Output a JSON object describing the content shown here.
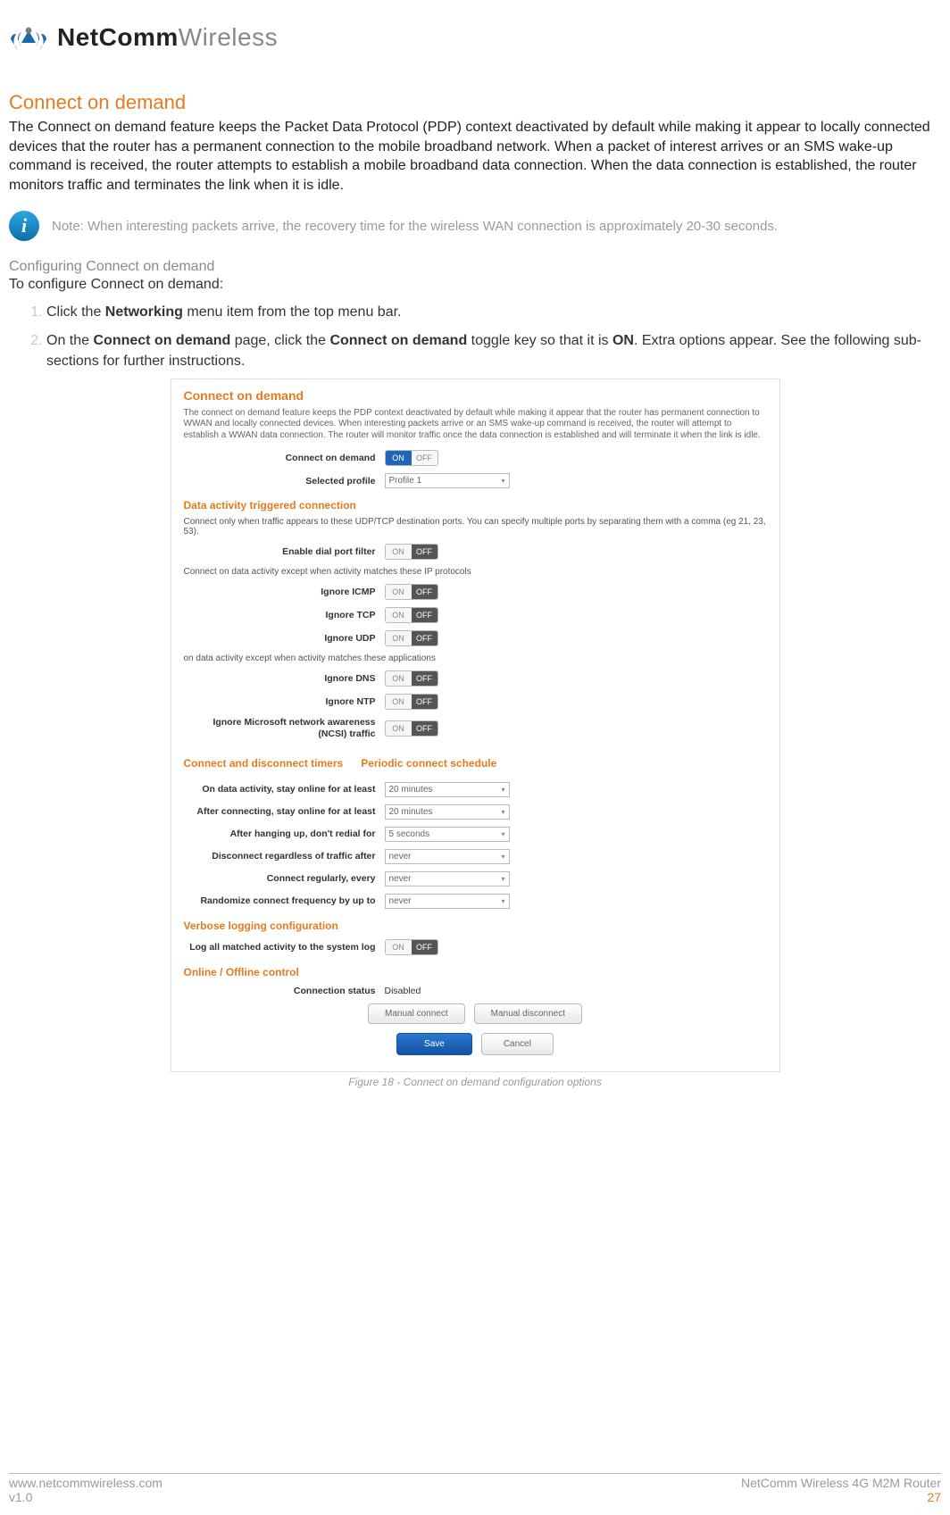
{
  "logo": {
    "bold": "NetComm",
    "light": "Wireless"
  },
  "heading": "Connect on demand",
  "paragraph": "The Connect on demand feature keeps the Packet Data Protocol (PDP) context deactivated by default while making it appear to locally connected devices that the router has a permanent connection to the mobile broadband network. When a packet of interest arrives or an SMS wake-up command is received, the router attempts to establish a mobile broadband data connection. When the data connection is established, the router monitors traffic and terminates the link when it is idle.",
  "note": "Note: When interesting packets arrive, the recovery time for the wireless WAN connection is approximately 20-30 seconds.",
  "subheading": "Configuring Connect on demand",
  "introLine": "To configure Connect on demand:",
  "step1": {
    "pre": "Click the ",
    "b": "Networking",
    "post": " menu item from the top menu bar."
  },
  "step2": {
    "pre": "On the ",
    "b1": "Connect on demand",
    "mid": " page, click the ",
    "b2": "Connect on demand",
    "mid2": " toggle key so that it is ",
    "b3": "ON",
    "post": ". Extra options appear. See the following sub-sections for further instructions."
  },
  "figureCaption": "Figure 18 - Connect on demand configuration options",
  "ss": {
    "title": "Connect on demand",
    "desc": "The connect on demand feature keeps the PDP context deactivated by default while making it appear that the router has permanent connection to WWAN and locally connected devices. When interesting packets arrive or an SMS wake-up command is received, the router will attempt to establish a WWAN data connection. The router will monitor traffic once the data connection is established and will terminate it when the link is idle.",
    "labels": {
      "cod": "Connect on demand",
      "profile": "Selected profile",
      "sec1": "Data activity triggered connection",
      "sec1desc": "Connect only when traffic appears to these UDP/TCP destination ports. You can specify multiple ports by separating them with a comma (eg 21, 23, 53).",
      "dialFilter": "Enable dial port filter",
      "except1": "Connect on data activity except when activity matches these IP protocols",
      "ignoreICMP": "Ignore ICMP",
      "ignoreTCP": "Ignore TCP",
      "ignoreUDP": "Ignore UDP",
      "except2": "on data activity except when activity matches these applications",
      "ignoreDNS": "Ignore DNS",
      "ignoreNTP": "Ignore NTP",
      "ignoreNCSI": "Ignore Microsoft network awareness (NCSI) traffic",
      "sec2a": "Connect and disconnect timers",
      "sec2b": "Periodic connect schedule",
      "onData": "On data activity, stay online for at least",
      "afterConn": "After connecting, stay online for at least",
      "afterHang": "After hanging up, don't redial for",
      "discAfter": "Disconnect regardless of traffic after",
      "connEvery": "Connect regularly, every",
      "randFreq": "Randomize connect frequency by up to",
      "sec3": "Verbose logging configuration",
      "logAll": "Log all matched activity to the system log",
      "sec4": "Online / Offline control",
      "connStatus": "Connection status"
    },
    "values": {
      "profile": "Profile 1",
      "onData": "20 minutes",
      "afterConn": "20 minutes",
      "afterHang": "5 seconds",
      "discAfter": "never",
      "connEvery": "never",
      "randFreq": "never",
      "connStatus": "Disabled",
      "on": "ON",
      "off": "OFF",
      "manConn": "Manual connect",
      "manDisc": "Manual disconnect",
      "save": "Save",
      "cancel": "Cancel"
    }
  },
  "footer": {
    "url": "www.netcommwireless.com",
    "ver": "v1.0",
    "product": "NetComm Wireless 4G M2M Router",
    "page": "27"
  }
}
